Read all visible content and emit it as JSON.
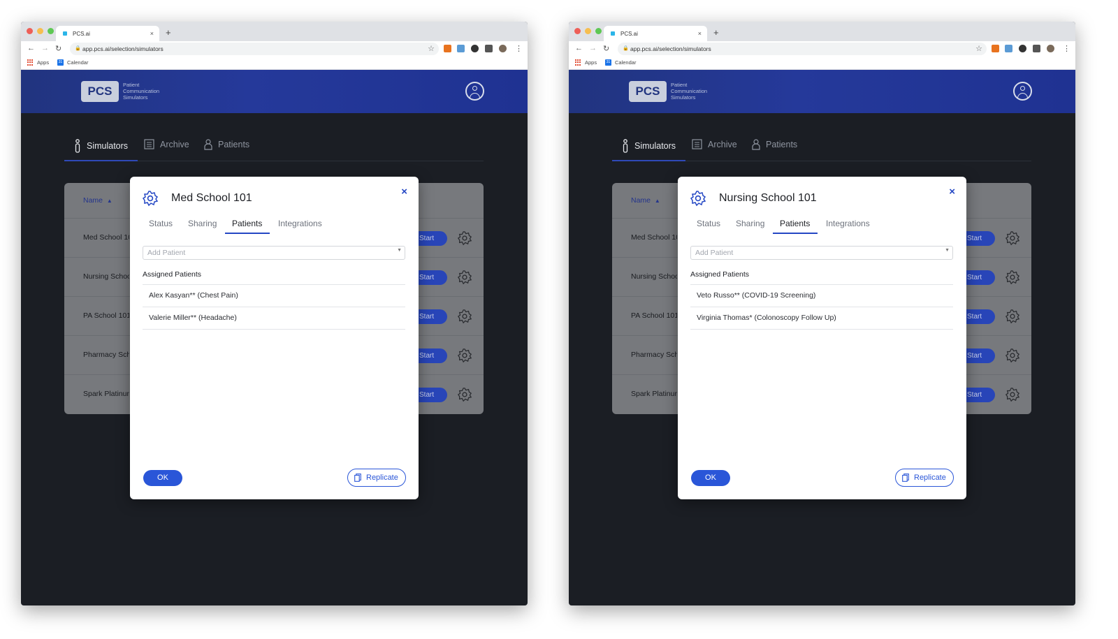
{
  "colors": {
    "header_blue": "#21347f",
    "accent": "#2447c4",
    "background_dark": "#1b1e24",
    "table_gray": "#77797d"
  },
  "screens": [
    {
      "browser": {
        "tab_title": "PCS.ai",
        "tab_close": "×",
        "new_tab": "+",
        "url": "app.pcs.ai/selection/simulators",
        "bookmarks": [
          "Apps",
          "Calendar"
        ]
      },
      "header": {
        "logo": "PCS",
        "tagline": [
          "Patient",
          "Communication",
          "Simulators"
        ]
      },
      "nav": [
        {
          "label": "Simulators",
          "icon": "person-icon",
          "active": true
        },
        {
          "label": "Archive",
          "icon": "document-icon",
          "active": false
        },
        {
          "label": "Patients",
          "icon": "patient-icon",
          "active": false
        }
      ],
      "table": {
        "column_name": "Name",
        "sort_indicator": "▲",
        "rows": [
          "Med School 101",
          "Nursing School 101",
          "PA School 101",
          "Pharmacy School 101",
          "Spark Platinum"
        ],
        "start_label": "Start"
      },
      "modal": {
        "title": "Med School 101",
        "close": "×",
        "tabs": [
          "Status",
          "Sharing",
          "Patients",
          "Integrations"
        ],
        "active_tab": "Patients",
        "add_patient_placeholder": "Add Patient",
        "assigned_heading": "Assigned Patients",
        "patients": [
          "Alex Kasyan** (Chest Pain)",
          "Valerie Miller** (Headache)"
        ],
        "ok_label": "OK",
        "replicate_label": "Replicate"
      }
    },
    {
      "browser": {
        "tab_title": "PCS.ai",
        "tab_close": "×",
        "new_tab": "+",
        "url": "app.pcs.ai/selection/simulators",
        "bookmarks": [
          "Apps",
          "Calendar"
        ]
      },
      "header": {
        "logo": "PCS",
        "tagline": [
          "Patient",
          "Communication",
          "Simulators"
        ]
      },
      "nav": [
        {
          "label": "Simulators",
          "icon": "person-icon",
          "active": true
        },
        {
          "label": "Archive",
          "icon": "document-icon",
          "active": false
        },
        {
          "label": "Patients",
          "icon": "patient-icon",
          "active": false
        }
      ],
      "table": {
        "column_name": "Name",
        "sort_indicator": "▲",
        "rows": [
          "Med School 101",
          "Nursing School 101",
          "PA School 101",
          "Pharmacy School 101",
          "Spark Platinum"
        ],
        "start_label": "Start"
      },
      "modal": {
        "title": "Nursing School 101",
        "close": "×",
        "tabs": [
          "Status",
          "Sharing",
          "Patients",
          "Integrations"
        ],
        "active_tab": "Patients",
        "add_patient_placeholder": "Add Patient",
        "assigned_heading": "Assigned Patients",
        "patients": [
          "Veto Russo** (COVID-19 Screening)",
          "Virginia Thomas* (Colonoscopy Follow Up)"
        ],
        "ok_label": "OK",
        "replicate_label": "Replicate"
      }
    }
  ]
}
